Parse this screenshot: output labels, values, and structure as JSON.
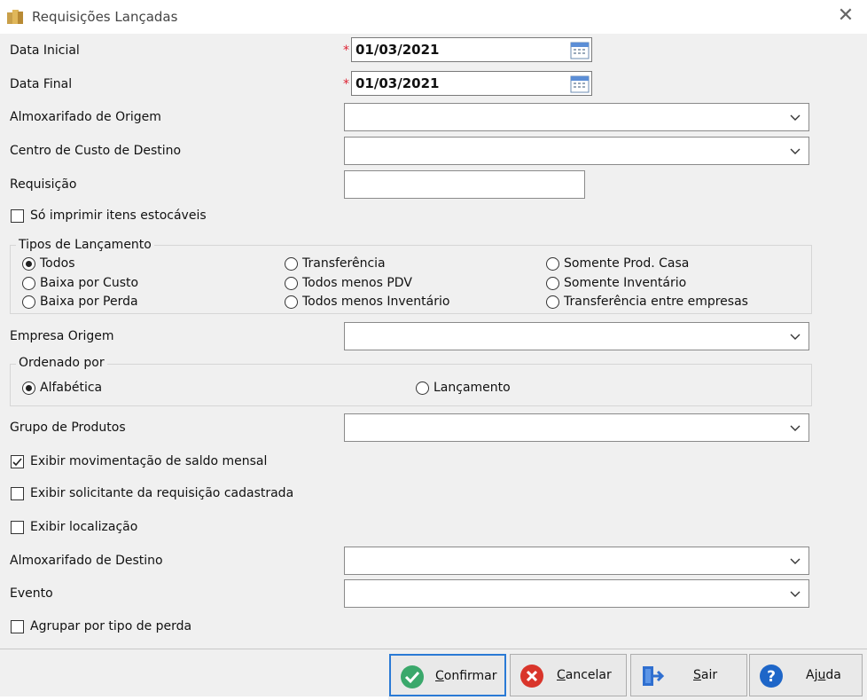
{
  "window": {
    "title": "Requisições Lançadas"
  },
  "form": {
    "data_inicial": {
      "label": "Data Inicial",
      "value": "01/03/2021",
      "required_mark": "*"
    },
    "data_final": {
      "label": "Data Final",
      "value": "01/03/2021",
      "required_mark": "*"
    },
    "almoxarifado_origem": {
      "label": "Almoxarifado de Origem",
      "value": ""
    },
    "centro_custo_destino": {
      "label": "Centro de Custo de Destino",
      "value": ""
    },
    "requisicao": {
      "label": "Requisição",
      "value": ""
    },
    "so_imprimir": {
      "label": "Só imprimir itens estocáveis",
      "checked": false
    },
    "tipos_lancamento": {
      "title": "Tipos de Lançamento",
      "options": [
        {
          "label": "Todos",
          "selected": true
        },
        {
          "label": "Baixa por Custo",
          "selected": false
        },
        {
          "label": "Baixa por Perda",
          "selected": false
        },
        {
          "label": "Transferência",
          "selected": false
        },
        {
          "label": "Todos menos PDV",
          "selected": false
        },
        {
          "label": "Todos menos Inventário",
          "selected": false
        },
        {
          "label": "Somente Prod. Casa",
          "selected": false
        },
        {
          "label": "Somente Inventário",
          "selected": false
        },
        {
          "label": "Transferência entre empresas",
          "selected": false
        }
      ]
    },
    "empresa_origem": {
      "label": "Empresa Origem",
      "value": ""
    },
    "ordenado_por": {
      "title": "Ordenado por",
      "options": [
        {
          "label": "Alfabética",
          "selected": true
        },
        {
          "label": "Lançamento",
          "selected": false
        }
      ]
    },
    "grupo_produtos": {
      "label": "Grupo de Produtos",
      "value": ""
    },
    "exibir_mov_saldo": {
      "label": "Exibir movimentação de saldo mensal",
      "checked": true
    },
    "exibir_solicitante": {
      "label": "Exibir solicitante da requisição cadastrada",
      "checked": false
    },
    "exibir_localizacao": {
      "label": "Exibir localização",
      "checked": false
    },
    "almoxarifado_destino": {
      "label": "Almoxarifado de Destino",
      "value": ""
    },
    "evento": {
      "label": "Evento",
      "value": ""
    },
    "agrupar_perda": {
      "label": "Agrupar por tipo de perda",
      "checked": false
    }
  },
  "buttons": {
    "confirmar": {
      "mnemonic": "C",
      "rest": "onfirmar"
    },
    "cancelar": {
      "mnemonic": "C",
      "rest": "ancelar"
    },
    "sair": {
      "mnemonic": "S",
      "rest": "air"
    },
    "ajuda": {
      "prefix": "Aj",
      "mnemonic": "u",
      "rest": "da"
    }
  },
  "colors": {
    "accent": "#2a7ad5",
    "confirm": "#3aa86b",
    "cancel": "#d9352b",
    "help": "#1e66c8",
    "exit": "#2f6fd0",
    "required": "#dd2233"
  }
}
